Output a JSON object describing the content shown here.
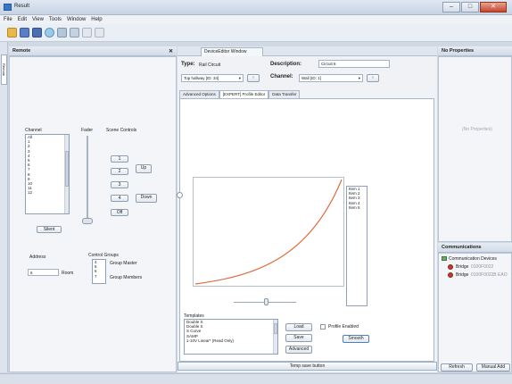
{
  "window": {
    "title": "Result",
    "minimize": "–",
    "maximize": "□",
    "close": "✕"
  },
  "menu": [
    "File",
    "Edit",
    "View",
    "Tools",
    "Window",
    "Help"
  ],
  "remote": {
    "title": "Remote",
    "channel_label": "Channel",
    "channels": [
      "All",
      "1",
      "2",
      "3",
      "4",
      "5",
      "6",
      "7",
      "8",
      "9",
      "10",
      "11",
      "12"
    ],
    "fader_label": "Fader",
    "scene_label": "Scene Controls",
    "scene_buttons": [
      "1",
      "2",
      "3",
      "4",
      "Off"
    ],
    "up_label": "Up",
    "down_label": "Down",
    "silent_label": "Silent",
    "address_label": "Address",
    "address_value": "6",
    "room_label": "Room",
    "control_groups_label": "Control Groups",
    "groups": [
      "4",
      "5",
      "6",
      "7"
    ],
    "group_master_label": "Group Master",
    "group_members_label": "Group Members"
  },
  "editor": {
    "tab_title": "DeviceEditor Window",
    "type_label": "Type:",
    "type_value": "Rail Circuit",
    "description_label": "Description:",
    "description_value": "Circuit 6",
    "device_value": "Top hallway [ID: 34]",
    "channel_label": "Channel:",
    "channel_value": "Wall [ID: 1]",
    "inner_tabs": [
      "Advanced Options",
      "[EXPERT] Profile Editor",
      "Data Transfer"
    ],
    "items": [
      "Item 1",
      "Item 2",
      "Item 3",
      "Item 4",
      "Item 5"
    ],
    "templates_label": "Templates",
    "templates": [
      "Double S",
      "Double S",
      "S Curve",
      "SAMP",
      "1-10V Linear* (Read Only)"
    ],
    "load_label": "Load",
    "save_label": "Save",
    "advanced_label": "Advanced",
    "profile_enabled_label": "Profile Enabled",
    "smooth_label": "Smooth",
    "temp_save_label": "Temp save button"
  },
  "properties": {
    "title": "No Properties",
    "placeholder": "(No Properties)"
  },
  "communications": {
    "title": "Communications",
    "tree_root": "Communication Devices",
    "bridges": [
      {
        "name": "Bridge",
        "id": "0100F0022"
      },
      {
        "name": "Bridge",
        "id": "0100F0022B EAO"
      }
    ],
    "refresh_label": "Refresh",
    "manual_add_label": "Manual Add"
  },
  "colors": {
    "curve": "#e2693e",
    "accent": "#3a76c7",
    "bridge_status": "#c2392b"
  }
}
